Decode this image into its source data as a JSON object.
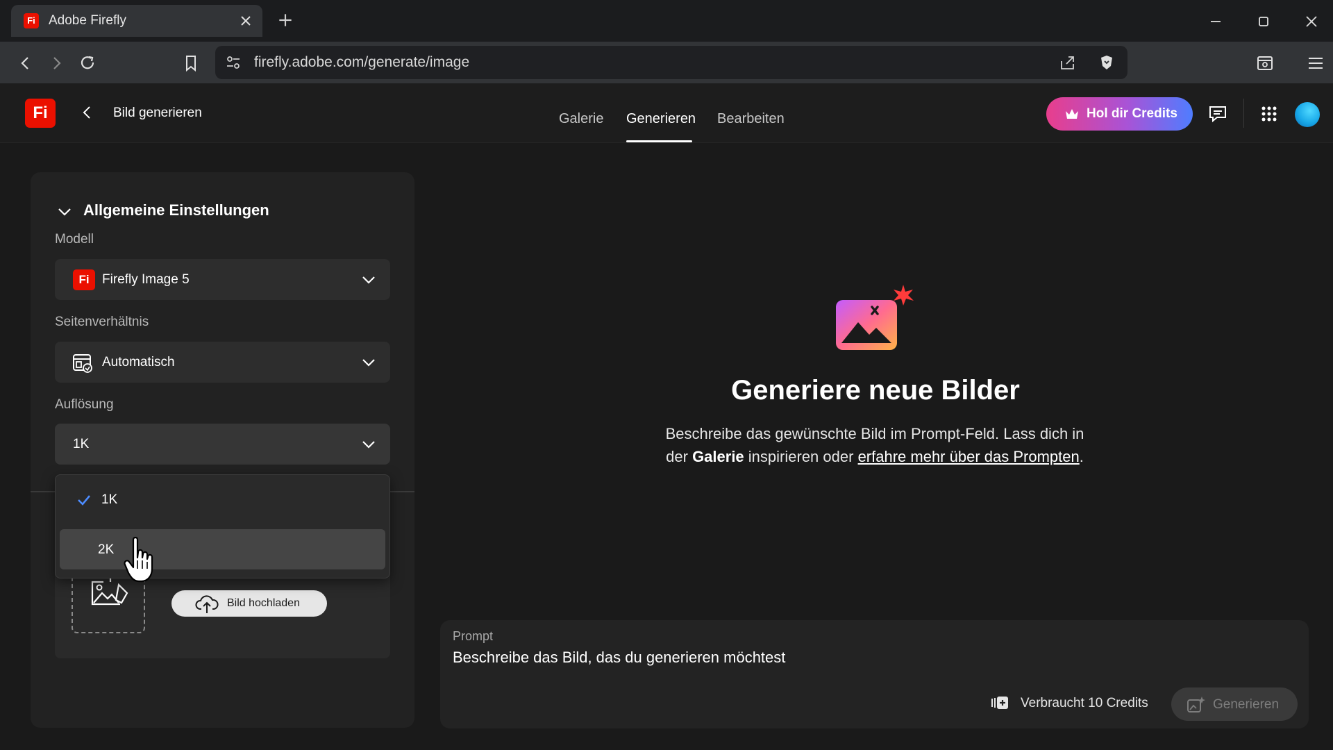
{
  "browser": {
    "tab_title": "Adobe Firefly",
    "tab_favicon": "Fi",
    "url": "firefly.adobe.com/generate/image"
  },
  "header": {
    "logo": "Fi",
    "page_title": "Bild generieren",
    "nav": [
      "Galerie",
      "Generieren",
      "Bearbeiten"
    ],
    "active_nav": "Generieren",
    "credits_button": "Hol dir Credits"
  },
  "settings": {
    "section_title": "Allgemeine Einstellungen",
    "model_label": "Modell",
    "model_value": "Firefly Image 5",
    "model_icon": "Fi",
    "ratio_label": "Seitenverhältnis",
    "ratio_value": "Automatisch",
    "resolution_label": "Auflösung",
    "resolution_value": "1K",
    "resolution_options": [
      "1K",
      "2K"
    ],
    "upload_button": "Bild hochladen"
  },
  "main": {
    "title": "Generiere neue Bilder",
    "description_part1": "Beschreibe das gewünschte Bild im Prompt-Feld. Lass dich in der",
    "description_bold": "Galerie",
    "description_part2": "inspirieren oder",
    "description_link": "erfahre mehr über das Prompten",
    "description_end": "."
  },
  "prompt": {
    "label": "Prompt",
    "placeholder": "Beschreibe das Bild, das du generieren möchtest",
    "cost": "Verbraucht 10 Credits",
    "generate_button": "Generieren"
  },
  "colors": {
    "adobe_red": "#eb1000",
    "accent_check": "#4d8cff",
    "credits_gradient_start": "#e83e8c",
    "credits_gradient_end": "#4f7dff"
  }
}
